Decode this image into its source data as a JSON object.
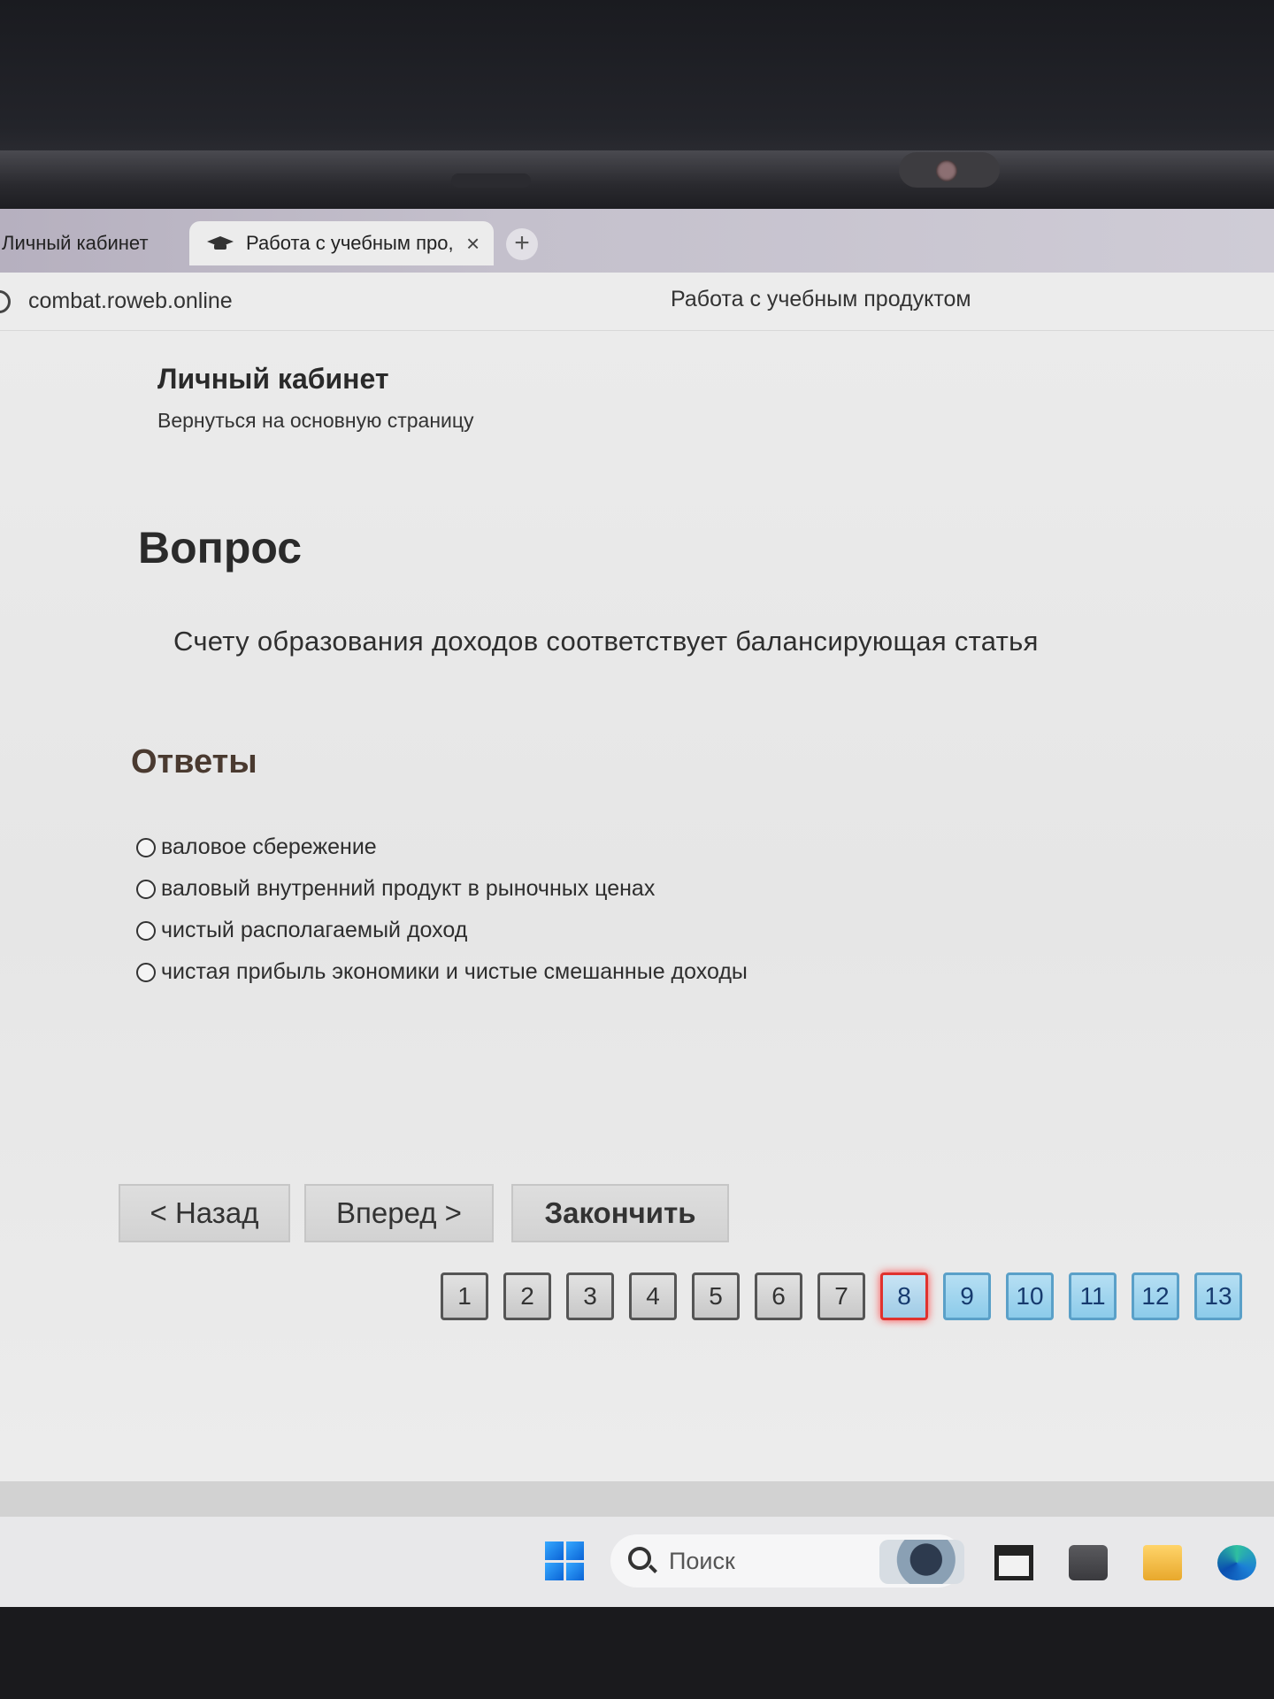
{
  "browser": {
    "tabs": [
      {
        "label": "Личный кабинет",
        "active": false
      },
      {
        "label": "Работа с учебным про,",
        "active": true
      }
    ],
    "tab_close": "×",
    "new_tab": "+",
    "url": "combat.roweb.online",
    "page_title": "Работа с учебным продуктом"
  },
  "page": {
    "cabinet_title": "Личный кабинет",
    "back_link": "Вернуться на основную страницу",
    "question_heading": "Вопрос",
    "question_text": "Счету образования доходов соответствует балансирующая статья",
    "answers_heading": "Ответы",
    "answers": [
      "валовое сбережение",
      "валовый внутренний продукт в рыночных ценах",
      "чистый располагаемый доход",
      "чистая прибыль экономики и чистые смешанные доходы"
    ],
    "buttons": {
      "back": "< Назад",
      "next": "Вперед >",
      "finish": "Закончить"
    },
    "pages": [
      {
        "label": "1",
        "state": "done"
      },
      {
        "label": "2",
        "state": "done"
      },
      {
        "label": "3",
        "state": "done"
      },
      {
        "label": "4",
        "state": "done"
      },
      {
        "label": "5",
        "state": "done"
      },
      {
        "label": "6",
        "state": "done"
      },
      {
        "label": "7",
        "state": "done"
      },
      {
        "label": "8",
        "state": "current"
      },
      {
        "label": "9",
        "state": "todo"
      },
      {
        "label": "10",
        "state": "todo"
      },
      {
        "label": "11",
        "state": "todo"
      },
      {
        "label": "12",
        "state": "todo"
      },
      {
        "label": "13",
        "state": "todo"
      }
    ],
    "colors": {
      "current_border": "#e0322e",
      "todo_fill": "#8ccbea"
    }
  },
  "taskbar": {
    "search_label": "Поиск",
    "icons": [
      "windows-start-icon",
      "search-icon",
      "widget-bird-icon",
      "task-view-icon",
      "app-icon",
      "file-explorer-icon",
      "edge-icon"
    ]
  }
}
